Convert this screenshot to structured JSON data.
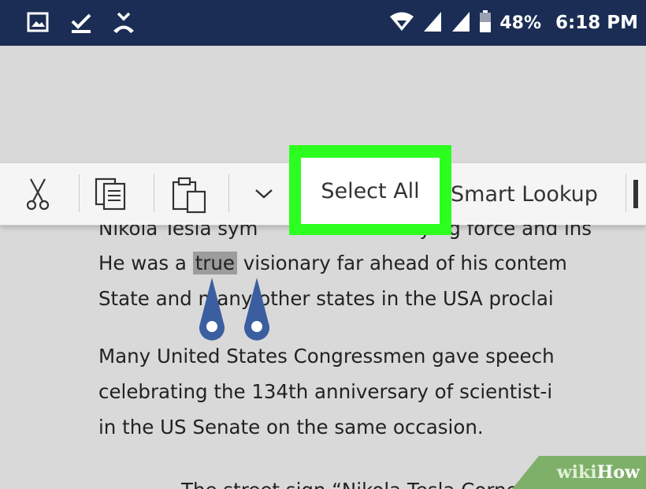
{
  "status_bar": {
    "icons": [
      "gallery-icon",
      "checkmark-icon",
      "missed-call-icon",
      "wifi-icon",
      "signal-icon",
      "signal-icon-2",
      "battery-icon"
    ],
    "battery_percent": "48%",
    "time": "6:18 PM"
  },
  "toolbar": {
    "icons": [
      "scissors-icon",
      "copy-icon",
      "paste-icon",
      "chevron-down-icon"
    ],
    "select_all_label": "Select All",
    "smart_lookup_label": "Smart Lookup"
  },
  "document": {
    "partial_top_line": "Nikola Tesla sym",
    "partial_top_line_right": "ying force and ins",
    "line1_before": "He was a ",
    "line1_selected": "true",
    "line1_after": " visionary far ahead of his contem",
    "line2": "State and many other states in the USA proclai",
    "para2_line1": "Many United States Congressmen gave speech",
    "para2_line2": "celebrating the 134th anniversary of scientist-i",
    "para2_line3": "in the US Senate on the same occasion.",
    "bottom_partial": "The street sign “Nikola Tesla Corner”"
  },
  "watermark": {
    "part1": "wiki",
    "part2": "How"
  },
  "colors": {
    "status_bar": "#1b2d54",
    "highlight": "#2cff1f",
    "handle": "#3b5ea0",
    "selection": "#9c9c9c"
  }
}
